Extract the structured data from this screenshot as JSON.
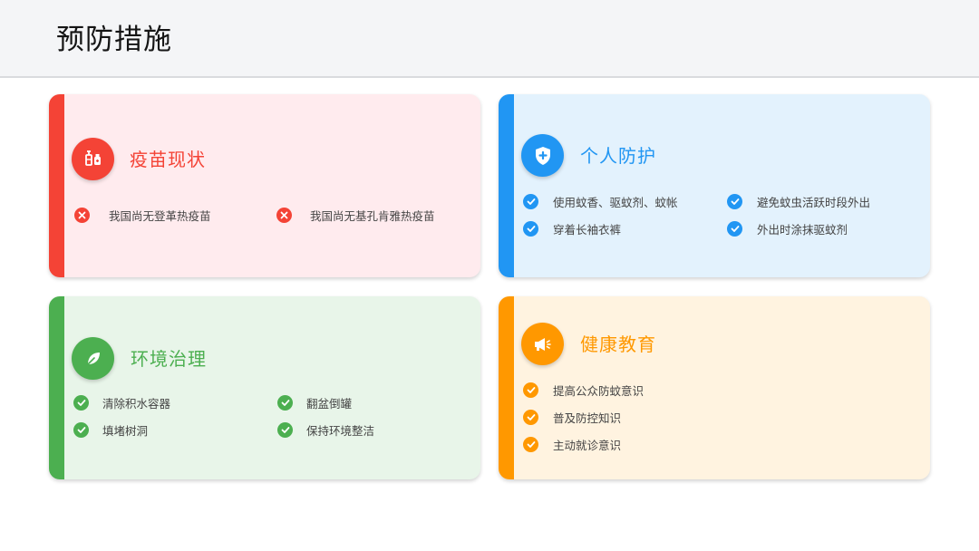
{
  "page": {
    "title": "预防措施"
  },
  "colors": {
    "red": "#f44336",
    "blue": "#2196f3",
    "green": "#4caf50",
    "orange": "#ff9800"
  },
  "cards": {
    "vaccine": {
      "icon": "vaccine-syringe-icon",
      "title": "疫苗现状",
      "items": [
        "我国尚无登革热疫苗",
        "我国尚无基孔肯雅热疫苗"
      ]
    },
    "personal": {
      "icon": "shield-plus-icon",
      "title": "个人防护",
      "items": [
        "使用蚊香、驱蚊剂、蚊帐",
        "避免蚊虫活跃时段外出",
        "穿着长袖衣裤",
        "外出时涂抹驱蚊剂"
      ]
    },
    "environment": {
      "icon": "leaf-icon",
      "title": "环境治理",
      "items": [
        "清除积水容器",
        "翻盆倒罐",
        "填堵树洞",
        "保持环境整洁"
      ]
    },
    "education": {
      "icon": "megaphone-icon",
      "title": "健康教育",
      "items": [
        "提高公众防蚊意识",
        "普及防控知识",
        "主动就诊意识"
      ]
    }
  }
}
